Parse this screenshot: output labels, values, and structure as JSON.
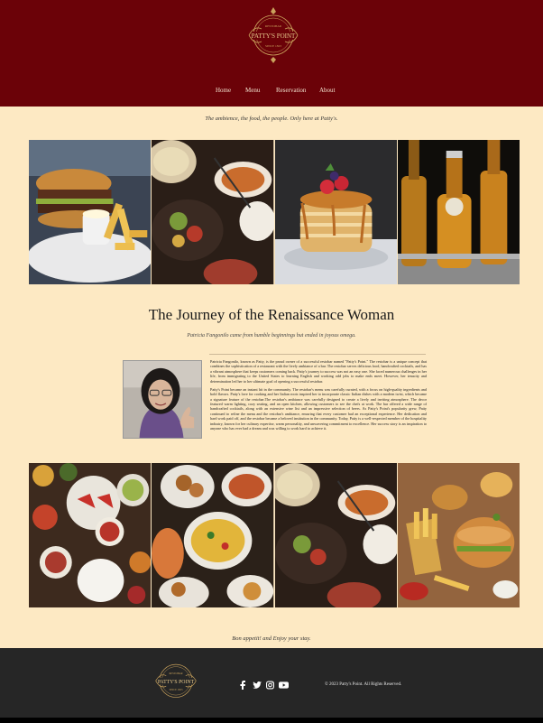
{
  "brand": {
    "name": "PATTY'S POINT",
    "tagline_top": "RESTOBAR",
    "since": "SINCE 1823"
  },
  "nav": {
    "items": [
      "Home",
      "Menu",
      "Reservation",
      "About"
    ]
  },
  "hero": {
    "tagline": "The ambience, the food, the people. Only here at Patty's."
  },
  "story": {
    "title": "The Journey of the Renaissance Woman",
    "subtitle": "Patricia Fangonilo came from humble beginnings but ended in joyous omega.",
    "paragraph1": "Patricia Fangonilo, known as Patty, is the proud owner of a successful restobar named \"Patty's Point.\" The restobar is a unique concept that combines the sophistication of a restaurant with the lively ambiance of a bar. The restobar serves delicious food, handcrafted cocktails, and has a vibrant atmosphere that keeps customers coming back. Patty's journey to success was not an easy one. She faced numerous challenges in her life, from immigrating to the United States to learning English and working odd jobs to make ends meet. However, her tenacity and determination led her to her ultimate goal of opening a successful restobar.",
    "paragraph2": "Patty's Point became an instant hit in the community. The restobar's menu was carefully curated, with a focus on high-quality ingredients and bold flavors. Patty's love for cooking and her Italian roots inspired her to incorporate classic Italian dishes with a modern twist, which became a signature feature of the restobar.The restobar's ambiance was carefully designed to create a lively and inviting atmosphere. The decor featured warm lighting, cozy seating, and an open kitchen, allowing customers to see the chefs at work. The bar offered a wide range of handcrafted cocktails, along with an extensive wine list and an impressive selection of beers. As Patty's Point's popularity grew, Patty continued to refine the menu and the restobar's ambiance, ensuring that every customer had an exceptional experience. Her dedication and hard work paid off, and the restobar became a beloved institution in the community. Today, Patty is a well-respected member of the hospitality industry, known for her culinary expertise, warm personality, and unwavering commitment to excellence. Her success story is an inspiration to anyone who has ever had a dream and was willing to work hard to achieve it."
  },
  "closing": {
    "text": "Bon appetit! and Enjoy your stay."
  },
  "footer": {
    "copyright": "© 2023 Patty's Point. All Rights Reserved."
  },
  "colors": {
    "header_bg": "#6b0208",
    "page_bg": "#fde9c3",
    "footer_bg": "#262626",
    "gold": "#c9a25c"
  },
  "icons": [
    "facebook-icon",
    "twitter-icon",
    "instagram-icon",
    "youtube-icon"
  ]
}
